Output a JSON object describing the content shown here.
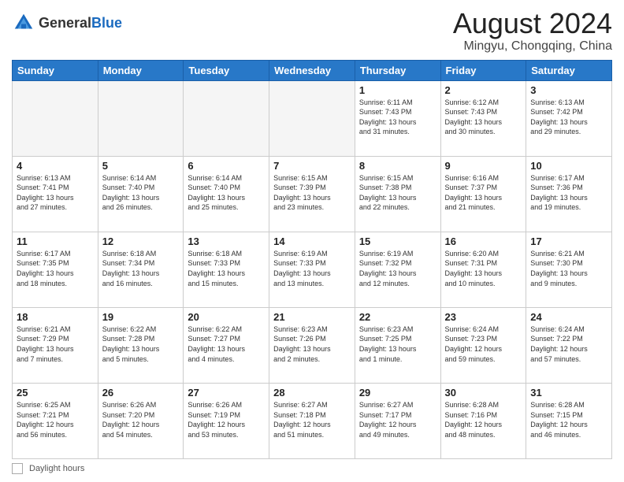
{
  "header": {
    "logo": {
      "general": "General",
      "blue": "Blue"
    },
    "title": "August 2024",
    "subtitle": "Mingyu, Chongqing, China"
  },
  "calendar": {
    "days_of_week": [
      "Sunday",
      "Monday",
      "Tuesday",
      "Wednesday",
      "Thursday",
      "Friday",
      "Saturday"
    ],
    "weeks": [
      [
        {
          "day": "",
          "info": ""
        },
        {
          "day": "",
          "info": ""
        },
        {
          "day": "",
          "info": ""
        },
        {
          "day": "",
          "info": ""
        },
        {
          "day": "1",
          "info": "Sunrise: 6:11 AM\nSunset: 7:43 PM\nDaylight: 13 hours\nand 31 minutes."
        },
        {
          "day": "2",
          "info": "Sunrise: 6:12 AM\nSunset: 7:43 PM\nDaylight: 13 hours\nand 30 minutes."
        },
        {
          "day": "3",
          "info": "Sunrise: 6:13 AM\nSunset: 7:42 PM\nDaylight: 13 hours\nand 29 minutes."
        }
      ],
      [
        {
          "day": "4",
          "info": "Sunrise: 6:13 AM\nSunset: 7:41 PM\nDaylight: 13 hours\nand 27 minutes."
        },
        {
          "day": "5",
          "info": "Sunrise: 6:14 AM\nSunset: 7:40 PM\nDaylight: 13 hours\nand 26 minutes."
        },
        {
          "day": "6",
          "info": "Sunrise: 6:14 AM\nSunset: 7:40 PM\nDaylight: 13 hours\nand 25 minutes."
        },
        {
          "day": "7",
          "info": "Sunrise: 6:15 AM\nSunset: 7:39 PM\nDaylight: 13 hours\nand 23 minutes."
        },
        {
          "day": "8",
          "info": "Sunrise: 6:15 AM\nSunset: 7:38 PM\nDaylight: 13 hours\nand 22 minutes."
        },
        {
          "day": "9",
          "info": "Sunrise: 6:16 AM\nSunset: 7:37 PM\nDaylight: 13 hours\nand 21 minutes."
        },
        {
          "day": "10",
          "info": "Sunrise: 6:17 AM\nSunset: 7:36 PM\nDaylight: 13 hours\nand 19 minutes."
        }
      ],
      [
        {
          "day": "11",
          "info": "Sunrise: 6:17 AM\nSunset: 7:35 PM\nDaylight: 13 hours\nand 18 minutes."
        },
        {
          "day": "12",
          "info": "Sunrise: 6:18 AM\nSunset: 7:34 PM\nDaylight: 13 hours\nand 16 minutes."
        },
        {
          "day": "13",
          "info": "Sunrise: 6:18 AM\nSunset: 7:33 PM\nDaylight: 13 hours\nand 15 minutes."
        },
        {
          "day": "14",
          "info": "Sunrise: 6:19 AM\nSunset: 7:33 PM\nDaylight: 13 hours\nand 13 minutes."
        },
        {
          "day": "15",
          "info": "Sunrise: 6:19 AM\nSunset: 7:32 PM\nDaylight: 13 hours\nand 12 minutes."
        },
        {
          "day": "16",
          "info": "Sunrise: 6:20 AM\nSunset: 7:31 PM\nDaylight: 13 hours\nand 10 minutes."
        },
        {
          "day": "17",
          "info": "Sunrise: 6:21 AM\nSunset: 7:30 PM\nDaylight: 13 hours\nand 9 minutes."
        }
      ],
      [
        {
          "day": "18",
          "info": "Sunrise: 6:21 AM\nSunset: 7:29 PM\nDaylight: 13 hours\nand 7 minutes."
        },
        {
          "day": "19",
          "info": "Sunrise: 6:22 AM\nSunset: 7:28 PM\nDaylight: 13 hours\nand 5 minutes."
        },
        {
          "day": "20",
          "info": "Sunrise: 6:22 AM\nSunset: 7:27 PM\nDaylight: 13 hours\nand 4 minutes."
        },
        {
          "day": "21",
          "info": "Sunrise: 6:23 AM\nSunset: 7:26 PM\nDaylight: 13 hours\nand 2 minutes."
        },
        {
          "day": "22",
          "info": "Sunrise: 6:23 AM\nSunset: 7:25 PM\nDaylight: 13 hours\nand 1 minute."
        },
        {
          "day": "23",
          "info": "Sunrise: 6:24 AM\nSunset: 7:23 PM\nDaylight: 12 hours\nand 59 minutes."
        },
        {
          "day": "24",
          "info": "Sunrise: 6:24 AM\nSunset: 7:22 PM\nDaylight: 12 hours\nand 57 minutes."
        }
      ],
      [
        {
          "day": "25",
          "info": "Sunrise: 6:25 AM\nSunset: 7:21 PM\nDaylight: 12 hours\nand 56 minutes."
        },
        {
          "day": "26",
          "info": "Sunrise: 6:26 AM\nSunset: 7:20 PM\nDaylight: 12 hours\nand 54 minutes."
        },
        {
          "day": "27",
          "info": "Sunrise: 6:26 AM\nSunset: 7:19 PM\nDaylight: 12 hours\nand 53 minutes."
        },
        {
          "day": "28",
          "info": "Sunrise: 6:27 AM\nSunset: 7:18 PM\nDaylight: 12 hours\nand 51 minutes."
        },
        {
          "day": "29",
          "info": "Sunrise: 6:27 AM\nSunset: 7:17 PM\nDaylight: 12 hours\nand 49 minutes."
        },
        {
          "day": "30",
          "info": "Sunrise: 6:28 AM\nSunset: 7:16 PM\nDaylight: 12 hours\nand 48 minutes."
        },
        {
          "day": "31",
          "info": "Sunrise: 6:28 AM\nSunset: 7:15 PM\nDaylight: 12 hours\nand 46 minutes."
        }
      ]
    ]
  },
  "footer": {
    "label": "Daylight hours"
  }
}
